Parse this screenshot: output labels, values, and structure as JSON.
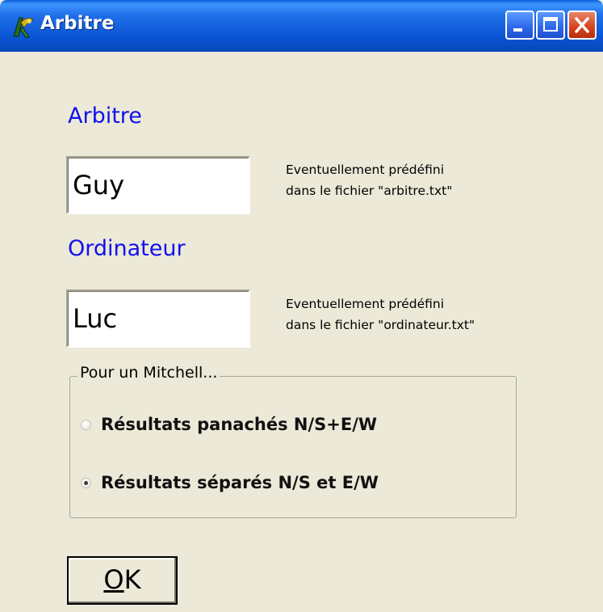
{
  "window": {
    "title": "Arbitre",
    "icon": "app-icon",
    "controls": {
      "minimize": "minimize-icon",
      "maximize": "maximize-icon",
      "close": "close-icon"
    }
  },
  "arbitre": {
    "label": "Arbitre",
    "value": "Guy",
    "hint_line1": "Eventuellement prédéfini",
    "hint_line2": "dans le fichier \"arbitre.txt\""
  },
  "ordinateur": {
    "label": "Ordinateur",
    "value": "Luc",
    "hint_line1": "Eventuellement prédéfini",
    "hint_line2": "dans le fichier \"ordinateur.txt\""
  },
  "mitchell": {
    "legend": "Pour un Mitchell...",
    "options": [
      {
        "label": "Résultats panachés N/S+E/W",
        "selected": false
      },
      {
        "label": "Résultats séparés N/S et E/W",
        "selected": true
      }
    ]
  },
  "ok_button": {
    "mnemonic": "O",
    "rest": "K"
  },
  "colors": {
    "label_blue": "#1111ee",
    "background": "#ece9d8",
    "titlebar": "#0a55d4"
  }
}
